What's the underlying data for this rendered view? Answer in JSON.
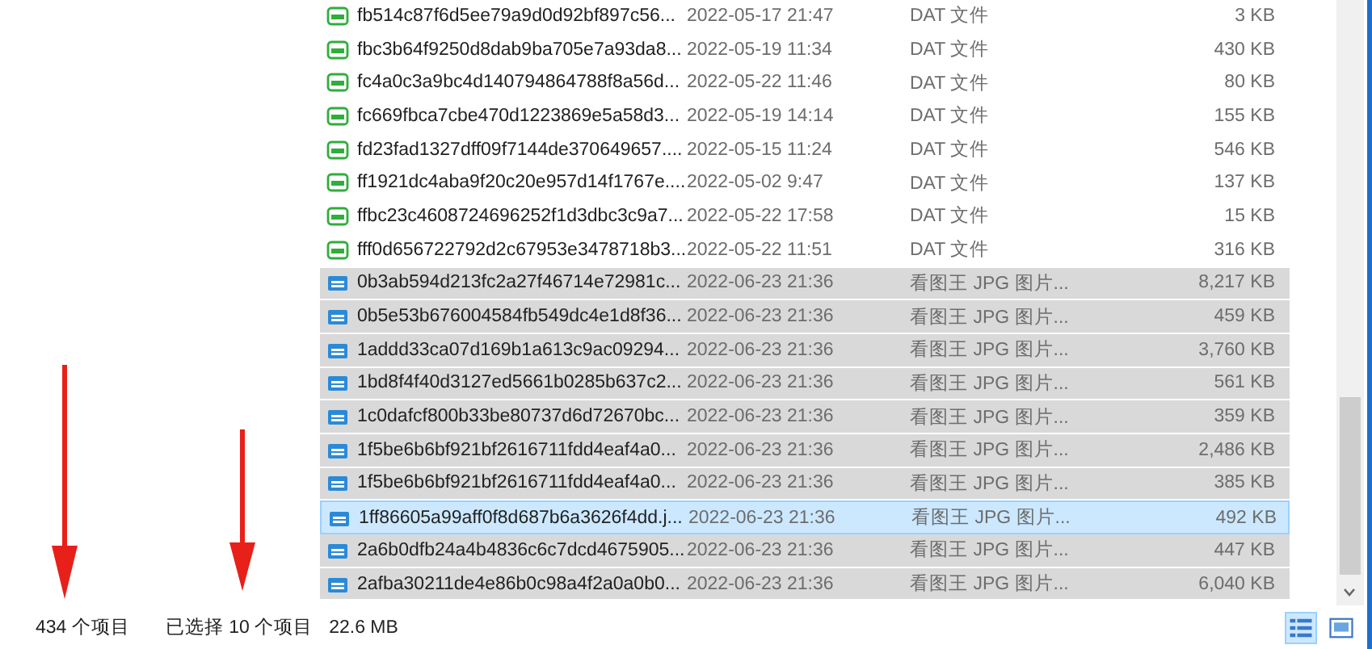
{
  "files": [
    {
      "name": "fb514c87f6d5ee79a9d0d92bf897c56...",
      "date": "2022-05-17 21:47",
      "type": "DAT 文件",
      "size": "3 KB",
      "kind": "dat",
      "selected": false,
      "focused": false
    },
    {
      "name": "fbc3b64f9250d8dab9ba705e7a93da8...",
      "date": "2022-05-19 11:34",
      "type": "DAT 文件",
      "size": "430 KB",
      "kind": "dat",
      "selected": false,
      "focused": false
    },
    {
      "name": "fc4a0c3a9bc4d140794864788f8a56d...",
      "date": "2022-05-22 11:46",
      "type": "DAT 文件",
      "size": "80 KB",
      "kind": "dat",
      "selected": false,
      "focused": false
    },
    {
      "name": "fc669fbca7cbe470d1223869e5a58d3...",
      "date": "2022-05-19 14:14",
      "type": "DAT 文件",
      "size": "155 KB",
      "kind": "dat",
      "selected": false,
      "focused": false
    },
    {
      "name": "fd23fad1327dff09f7144de370649657....",
      "date": "2022-05-15 11:24",
      "type": "DAT 文件",
      "size": "546 KB",
      "kind": "dat",
      "selected": false,
      "focused": false
    },
    {
      "name": "ff1921dc4aba9f20c20e957d14f1767e....",
      "date": "2022-05-02 9:47",
      "type": "DAT 文件",
      "size": "137 KB",
      "kind": "dat",
      "selected": false,
      "focused": false
    },
    {
      "name": "ffbc23c4608724696252f1d3dbc3c9a7...",
      "date": "2022-05-22 17:58",
      "type": "DAT 文件",
      "size": "15 KB",
      "kind": "dat",
      "selected": false,
      "focused": false
    },
    {
      "name": "fff0d656722792d2c67953e3478718b3...",
      "date": "2022-05-22 11:51",
      "type": "DAT 文件",
      "size": "316 KB",
      "kind": "dat",
      "selected": false,
      "focused": false
    },
    {
      "name": "0b3ab594d213fc2a27f46714e72981c...",
      "date": "2022-06-23 21:36",
      "type": "看图王 JPG 图片...",
      "size": "8,217 KB",
      "kind": "jpg",
      "selected": true,
      "focused": false
    },
    {
      "name": "0b5e53b676004584fb549dc4e1d8f36...",
      "date": "2022-06-23 21:36",
      "type": "看图王 JPG 图片...",
      "size": "459 KB",
      "kind": "jpg",
      "selected": true,
      "focused": false
    },
    {
      "name": "1addd33ca07d169b1a613c9ac09294...",
      "date": "2022-06-23 21:36",
      "type": "看图王 JPG 图片...",
      "size": "3,760 KB",
      "kind": "jpg",
      "selected": true,
      "focused": false
    },
    {
      "name": "1bd8f4f40d3127ed5661b0285b637c2...",
      "date": "2022-06-23 21:36",
      "type": "看图王 JPG 图片...",
      "size": "561 KB",
      "kind": "jpg",
      "selected": true,
      "focused": false
    },
    {
      "name": "1c0dafcf800b33be80737d6d72670bc...",
      "date": "2022-06-23 21:36",
      "type": "看图王 JPG 图片...",
      "size": "359 KB",
      "kind": "jpg",
      "selected": true,
      "focused": false
    },
    {
      "name": "1f5be6b6bf921bf2616711fdd4eaf4a0...",
      "date": "2022-06-23 21:36",
      "type": "看图王 JPG 图片...",
      "size": "2,486 KB",
      "kind": "jpg",
      "selected": true,
      "focused": false
    },
    {
      "name": "1f5be6b6bf921bf2616711fdd4eaf4a0...",
      "date": "2022-06-23 21:36",
      "type": "看图王 JPG 图片...",
      "size": "385 KB",
      "kind": "jpg",
      "selected": true,
      "focused": false
    },
    {
      "name": "1ff86605a99aff0f8d687b6a3626f4dd.j...",
      "date": "2022-06-23 21:36",
      "type": "看图王 JPG 图片...",
      "size": "492 KB",
      "kind": "jpg",
      "selected": true,
      "focused": true
    },
    {
      "name": "2a6b0dfb24a4b4836c6c7dcd4675905...",
      "date": "2022-06-23 21:36",
      "type": "看图王 JPG 图片...",
      "size": "447 KB",
      "kind": "jpg",
      "selected": true,
      "focused": false
    },
    {
      "name": "2afba30211de4e86b0c98a4f2a0a0b0...",
      "date": "2022-06-23 21:36",
      "type": "看图王 JPG 图片...",
      "size": "6,040 KB",
      "kind": "jpg",
      "selected": true,
      "focused": false
    }
  ],
  "status_bar": {
    "item_count": "434 个项目",
    "selection": "已选择 10 个项目",
    "selection_size": "22.6 MB"
  }
}
